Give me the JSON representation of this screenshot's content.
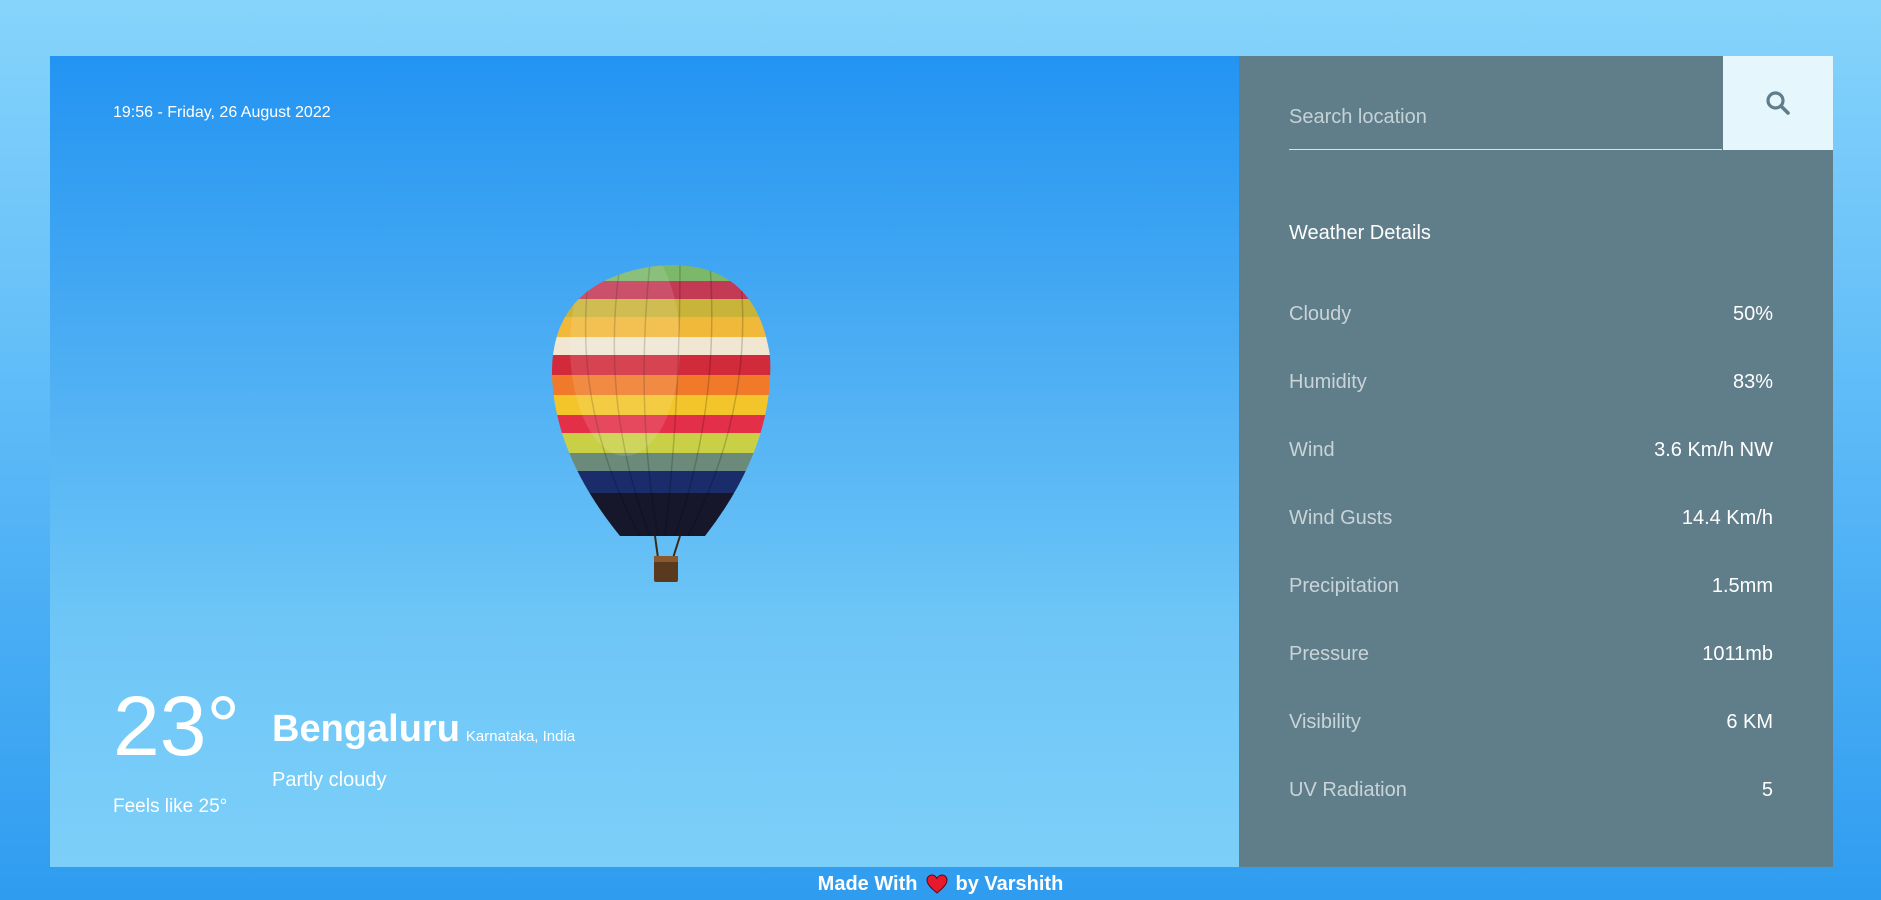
{
  "header": {
    "datetime": "19:56 - Friday, 26 August 2022"
  },
  "current": {
    "temperature": "23°",
    "feels_like": "Feels like 25°",
    "city": "Bengaluru",
    "region": "Karnataka, India",
    "condition": "Partly cloudy",
    "illustration": "hot-air-balloon"
  },
  "search": {
    "placeholder": "Search location",
    "value": "",
    "icon": "search-icon"
  },
  "details": {
    "title": "Weather Details",
    "rows": [
      {
        "label": "Cloudy",
        "value": "50%"
      },
      {
        "label": "Humidity",
        "value": "83%"
      },
      {
        "label": "Wind",
        "value": "3.6 Km/h NW"
      },
      {
        "label": "Wind Gusts",
        "value": "14.4 Km/h"
      },
      {
        "label": "Precipitation",
        "value": "1.5mm"
      },
      {
        "label": "Pressure",
        "value": "1011mb"
      },
      {
        "label": "Visibility",
        "value": "6 KM"
      },
      {
        "label": "UV Radiation",
        "value": "5"
      }
    ]
  },
  "footer": {
    "made_with": "Made With",
    "by": "by Varshith",
    "icon": "heart-icon"
  },
  "colors": {
    "panel": "#607d8a",
    "sky_top": "#2394f2",
    "sky_bottom": "#7ccff8",
    "search_button": "#e6f6fd",
    "heart": "#e8192c"
  }
}
